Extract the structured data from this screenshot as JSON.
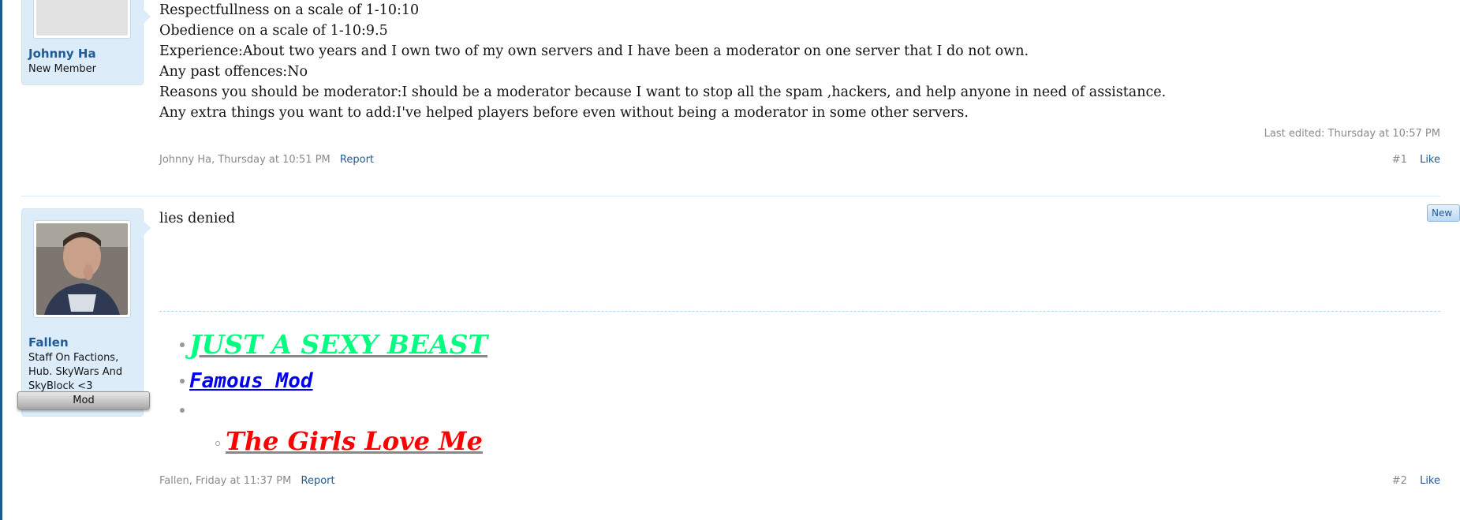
{
  "post1": {
    "message_lines": [
      "Respectfullness on a scale of 1-10:10",
      "Obedience on a scale of 1-10:9.5",
      "Experience:About two years and I own two of my own servers and I have been a moderator on one server that I do not own.",
      "Any past offences:No",
      "Reasons you should be moderator:I should be a moderator because I want to stop all the spam ,hackers, and help anyone in need of assistance.",
      "Any extra things you want to add:I've helped players before even without being a moderator in some other servers."
    ],
    "user": {
      "name": "Johnny Ha",
      "title": "New Member"
    },
    "last_edited": "Last edited: Thursday at 10:57 PM",
    "meta": "Johnny Ha, Thursday at 10:51 PM",
    "report": "Report",
    "number": "#1",
    "like": "Like"
  },
  "post2": {
    "message": "lies denied",
    "new_badge": "New",
    "user": {
      "name": "Fallen",
      "title": "Staff On Factions, Hub. SkyWars And SkyBlock <3",
      "banner": "Mod"
    },
    "signature": {
      "line1": "JUST A SEXY BEAST",
      "line2": "Famous  Mod",
      "line3": "The Girls Love Me"
    },
    "meta": "Fallen, Friday at 11:37 PM",
    "report": "Report",
    "number": "#2",
    "like": "Like"
  },
  "colors": {
    "link": "#1f5b94",
    "user_card": "#dcecf9",
    "sig_green": "#00ff80",
    "sig_blue": "#0000ee",
    "sig_red": "#ff0000"
  }
}
